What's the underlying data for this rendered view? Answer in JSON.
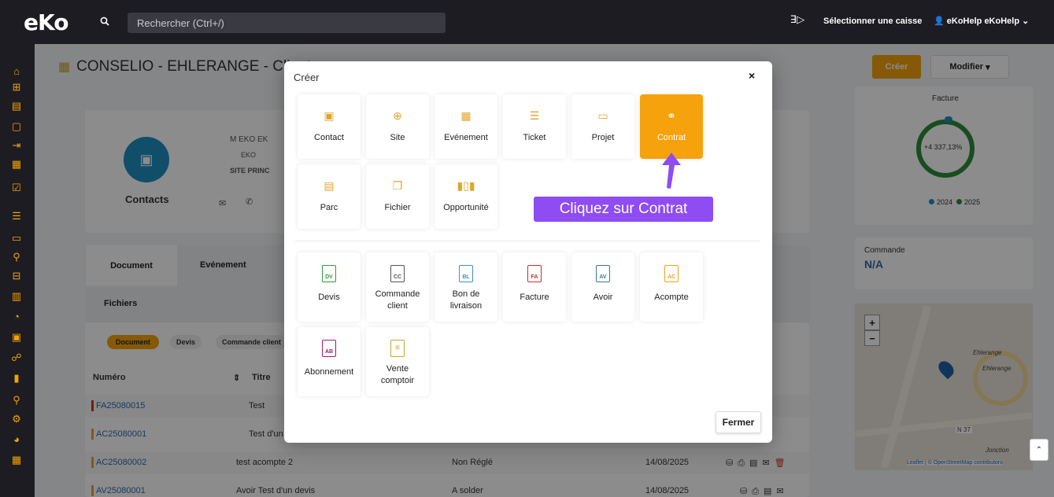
{
  "topbar": {
    "logo": "eKo",
    "search_placeholder": "Rechercher (Ctrl+/)",
    "caisse": "Sélectionner une caisse",
    "user": "eKoHelp eKoHelp"
  },
  "page": {
    "title": "CONSELIO - EHLERANGE - Client",
    "create_btn": "Créer",
    "modify_btn": "Modifier",
    "contact_card": {
      "label": "Contacts",
      "name": "M EKO EK",
      "company": "EKO",
      "site": "SITE PRINC"
    },
    "tabs": {
      "document": "Document",
      "evenement": "Evénement",
      "fichiers": "Fichiers"
    },
    "filters": [
      "Document",
      "Devis",
      "Commande client"
    ],
    "table": {
      "headers": [
        "Numéro",
        "Titre"
      ],
      "rows": [
        {
          "numero": "FA25080015",
          "titre": "Test",
          "statut": "",
          "date": "",
          "color": "#d0342c"
        },
        {
          "numero": "AC25080001",
          "titre": "Test d'un",
          "statut": "",
          "date": "",
          "color": "#e8a33c"
        },
        {
          "numero": "AC25080002",
          "titre": "test acompte 2",
          "statut": "Non Réglé",
          "date": "14/08/2025",
          "color": "#e8a33c"
        },
        {
          "numero": "AV25080001",
          "titre": "Avoir Test d'un devis",
          "statut": "A solder",
          "date": "14/08/2025",
          "color": "#e8a33c"
        }
      ]
    },
    "facture_widget": {
      "title": "Facture",
      "value": "+4 337,13%",
      "legend": [
        "2024",
        "2025"
      ]
    },
    "commande_widget": {
      "title": "Commande",
      "value": "N/A"
    },
    "map": {
      "labels": [
        "Ehlerange",
        "Ehlerange",
        "N 37",
        "Jonction"
      ],
      "attribution": "Leaflet | © OpenStreetMap contributors"
    }
  },
  "modal": {
    "title": "Créer",
    "close": "×",
    "row1": [
      {
        "label": "Contact",
        "icon": "contact-icon"
      },
      {
        "label": "Site",
        "icon": "location-pin-icon"
      },
      {
        "label": "Evénement",
        "icon": "calendar-icon"
      },
      {
        "label": "Ticket",
        "icon": "checklist-icon"
      },
      {
        "label": "Projet",
        "icon": "folder-icon"
      },
      {
        "label": "Contrat",
        "icon": "handshake-icon"
      }
    ],
    "row2": [
      {
        "label": "Parc",
        "icon": "box-icon"
      },
      {
        "label": "Fichier",
        "icon": "copy-icon"
      },
      {
        "label": "Opportunité",
        "icon": "bar-chart-icon"
      }
    ],
    "docs1": [
      {
        "label": "Devis",
        "code": "DV",
        "color": "#2e9a3c"
      },
      {
        "label": "Commande client",
        "code": "CC",
        "color": "#555"
      },
      {
        "label": "Bon de livraison",
        "code": "BL",
        "color": "#3b8fd0"
      },
      {
        "label": "Facture",
        "code": "FA",
        "color": "#c9302c"
      },
      {
        "label": "Avoir",
        "code": "AV",
        "color": "#3e7a8a"
      },
      {
        "label": "Acompte",
        "code": "AC",
        "color": "#f0a020"
      }
    ],
    "docs2": [
      {
        "label": "Abonnement",
        "code": "AB",
        "color": "#a0186e"
      },
      {
        "label": "Vente comptoir",
        "code": "",
        "color": "#c9a428"
      }
    ],
    "close_btn": "Fermer"
  },
  "callout": "Cliquez sur Contrat"
}
